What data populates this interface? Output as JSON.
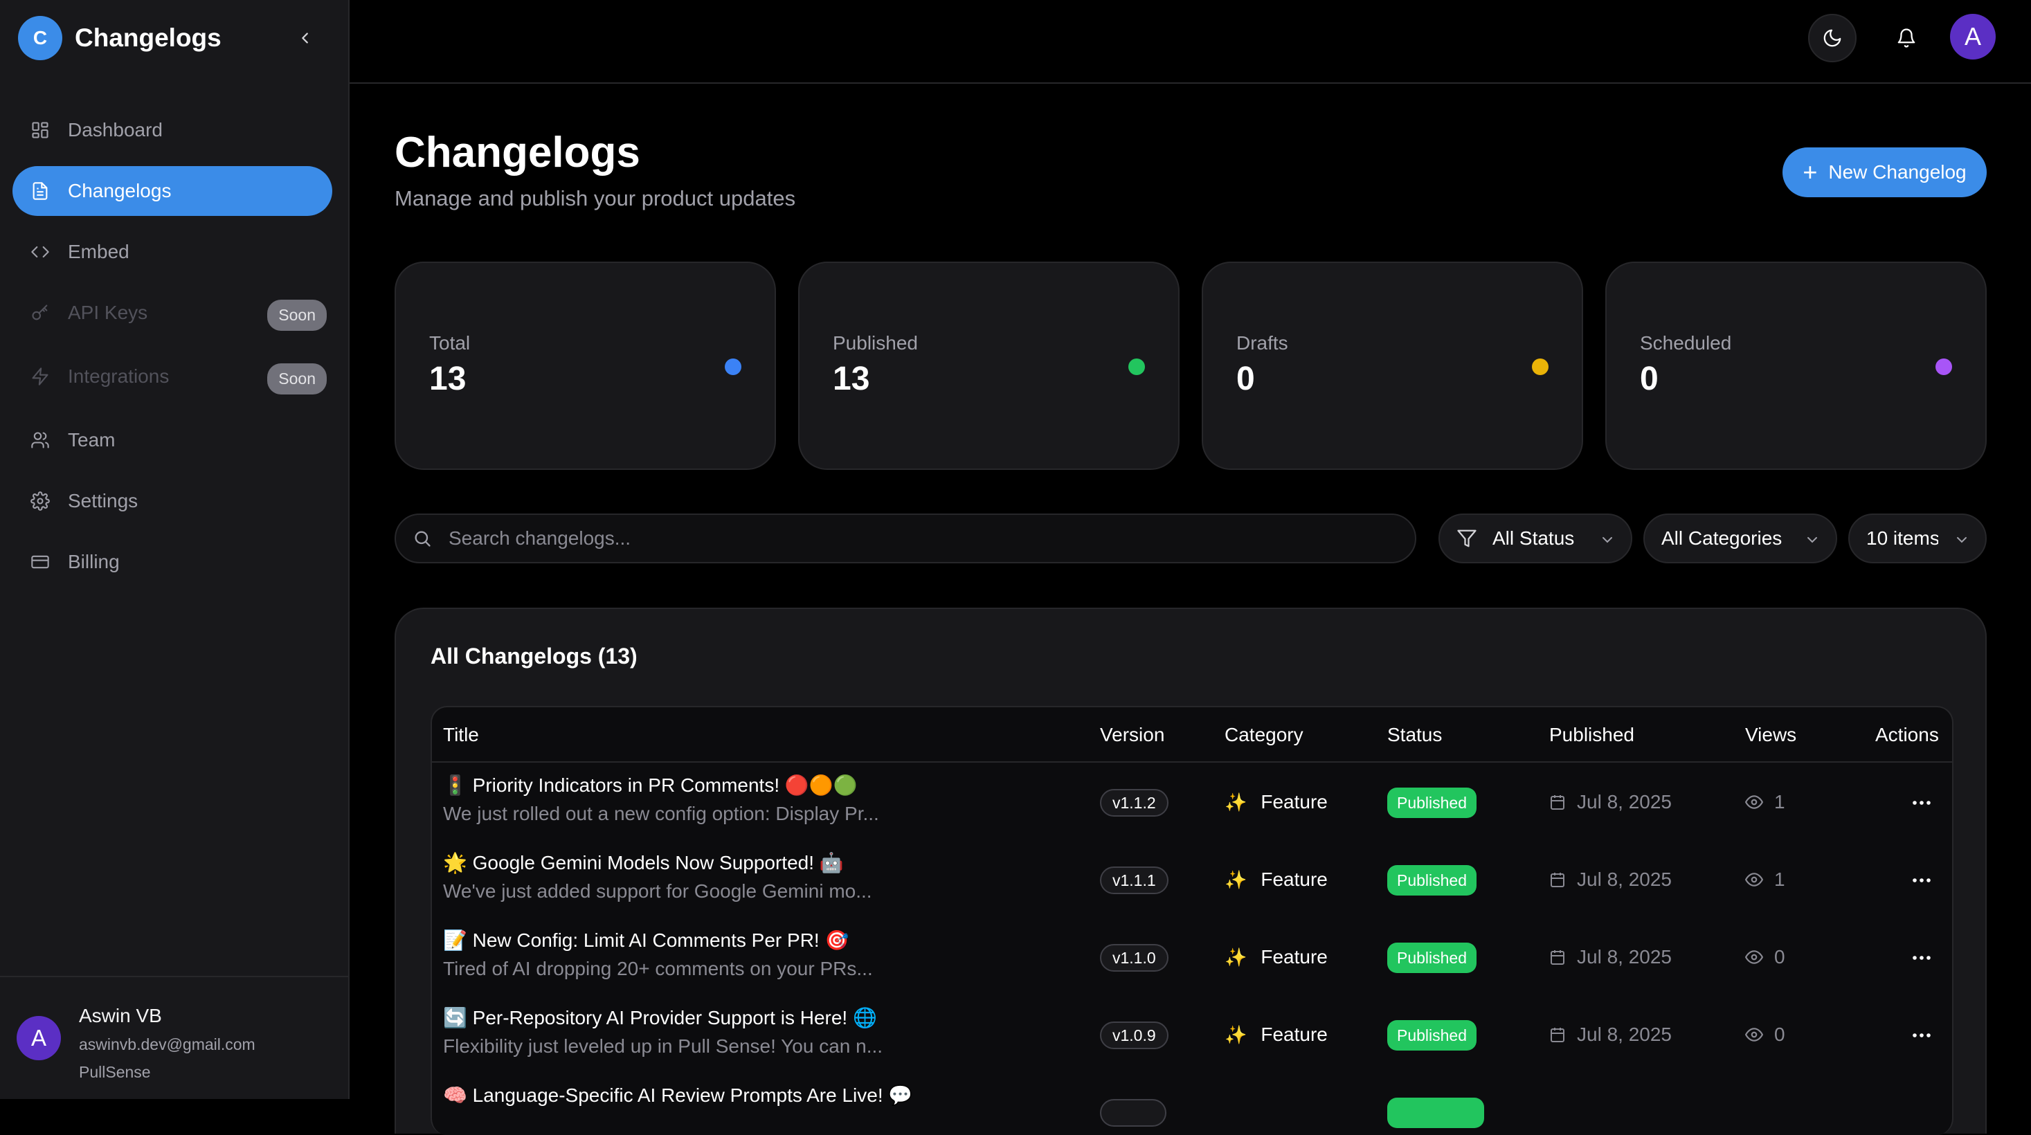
{
  "sidebar": {
    "brand": {
      "logo_letter": "C",
      "name": "Changelogs"
    },
    "items": [
      {
        "label": "Dashboard",
        "icon": "dashboard-grid-icon"
      },
      {
        "label": "Changelogs",
        "icon": "document-icon"
      },
      {
        "label": "Embed",
        "icon": "code-icon"
      },
      {
        "label": "API Keys",
        "icon": "key-icon",
        "badge": "Soon"
      },
      {
        "label": "Integrations",
        "icon": "lightning-icon",
        "badge": "Soon"
      },
      {
        "label": "Team",
        "icon": "users-icon"
      },
      {
        "label": "Settings",
        "icon": "gear-icon"
      },
      {
        "label": "Billing",
        "icon": "credit-card-icon"
      }
    ],
    "user": {
      "avatar_letter": "A",
      "name": "Aswin VB",
      "email": "aswinvb.dev@gmail.com",
      "org": "PullSense"
    }
  },
  "topbar": {
    "avatar_letter": "A"
  },
  "header": {
    "title": "Changelogs",
    "subtitle": "Manage and publish your product updates",
    "new_button": "New Changelog"
  },
  "stats": [
    {
      "label": "Total",
      "value": "13",
      "color": "#3b82f6"
    },
    {
      "label": "Published",
      "value": "13",
      "color": "#22c55e"
    },
    {
      "label": "Drafts",
      "value": "0",
      "color": "#eab308"
    },
    {
      "label": "Scheduled",
      "value": "0",
      "color": "#a855f7"
    }
  ],
  "filters": {
    "search_placeholder": "Search changelogs...",
    "status": "All Status",
    "categories": "All Categories",
    "items": "10 items"
  },
  "table": {
    "title": "All Changelogs (13)",
    "columns": [
      "Title",
      "Version",
      "Category",
      "Status",
      "Published",
      "Views",
      "Actions"
    ],
    "rows": [
      {
        "title": "🚦 Priority Indicators in PR Comments! 🔴🟠🟢",
        "desc": "We just rolled out a new config option: Display Pr...",
        "version": "v1.1.2",
        "category": "Feature",
        "status": "Published",
        "published": "Jul 8, 2025",
        "views": "1"
      },
      {
        "title": "🌟 Google Gemini Models Now Supported! 🤖",
        "desc": "We've just added support for Google Gemini mo...",
        "version": "v1.1.1",
        "category": "Feature",
        "status": "Published",
        "published": "Jul 8, 2025",
        "views": "1"
      },
      {
        "title": "📝 New Config: Limit AI Comments Per PR! 🎯",
        "desc": "Tired of AI dropping 20+ comments on your PRs...",
        "version": "v1.1.0",
        "category": "Feature",
        "status": "Published",
        "published": "Jul 8, 2025",
        "views": "0"
      },
      {
        "title": "🔄 Per-Repository AI Provider Support is Here! 🌐",
        "desc": "Flexibility just leveled up in Pull Sense! You can n...",
        "version": "v1.0.9",
        "category": "Feature",
        "status": "Published",
        "published": "Jul 8, 2025",
        "views": "0"
      },
      {
        "title": "🧠 Language-Specific AI Review Prompts Are Live! 💬",
        "desc": "",
        "version": "",
        "category": "",
        "status": "",
        "published": "",
        "views": ""
      }
    ]
  }
}
